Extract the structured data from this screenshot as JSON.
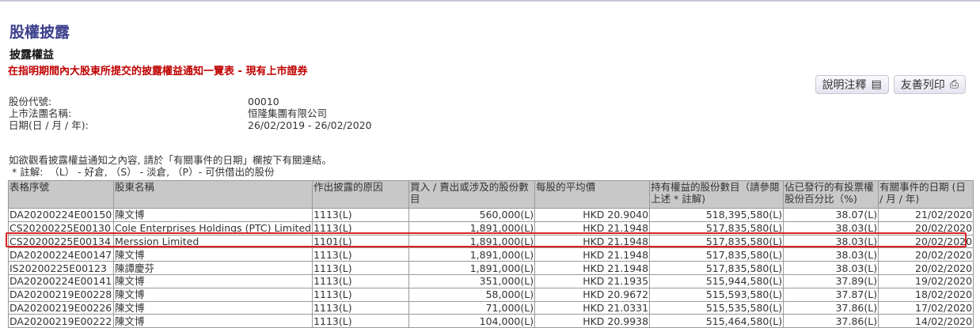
{
  "title": "股權披露",
  "subtitle": "披露權益",
  "list_title": "在指明期間內大股東所提交的披露權益通知一覽表 - 現有上市證券",
  "buttons": {
    "explain": "說明注釋",
    "print": "友善列印"
  },
  "info": [
    {
      "label": "股份代號:",
      "value": "00010"
    },
    {
      "label": "上市法團名稱:",
      "value": "恒隆集團有限公司"
    },
    {
      "label": "日期(日 / 月 / 年):",
      "value": "26/02/2019 - 26/02/2020"
    }
  ],
  "instruction": "如欲觀看披露權益通知之內容, 請於「有關事件的日期」欄按下有關連結。",
  "legend": " * 註解:  （L） - 好倉, （S） - 淡倉, （P）- 可供借出的股份",
  "columns": [
    "表格序號",
    "股東名稱",
    "作出披露的原因",
    "買入 / 賣出或涉及的股份數目",
    "每股的平均價",
    "持有權益的股份數目（請參閱上述 * 註解)",
    "佔已發行的有投票權股份百分比（%)",
    "有關事件的日期 (日 / 月 / 年)"
  ],
  "rows": [
    [
      "DA20200224E00150",
      "陳文博",
      "1113(L)",
      "560,000(L)",
      "HKD 20.9040",
      "518,395,580(L)",
      "38.07(L)",
      "21/02/2020"
    ],
    [
      "CS20200225E00130",
      "Cole Enterprises Holdings (PTC) Limited",
      "1113(L)",
      "1,891,000(L)",
      "HKD 21.1948",
      "517,835,580(L)",
      "38.03(L)",
      "20/02/2020"
    ],
    [
      "CS20200225E00134",
      "Merssion Limited",
      "1101(L)",
      "1,891,000(L)",
      "HKD 21.1948",
      "517,835,580(L)",
      "38.03(L)",
      "20/02/2020"
    ],
    [
      "DA20200224E00147",
      "陳文博",
      "1113(L)",
      "1,891,000(L)",
      "HKD 21.1948",
      "517,835,580(L)",
      "38.03(L)",
      "20/02/2020"
    ],
    [
      "IS20200225E00123",
      "陳譚慶芬",
      "1113(L)",
      "1,891,000(L)",
      "HKD 21.1948",
      "517,835,580(L)",
      "38.03(L)",
      "20/02/2020"
    ],
    [
      "DA20200224E00141",
      "陳文博",
      "1113(L)",
      "351,000(L)",
      "HKD 21.1935",
      "515,944,580(L)",
      "37.89(L)",
      "19/02/2020"
    ],
    [
      "DA20200219E00228",
      "陳文博",
      "1113(L)",
      "58,000(L)",
      "HKD 20.9672",
      "515,593,580(L)",
      "37.87(L)",
      "18/02/2020"
    ],
    [
      "DA20200219E00226",
      "陳文博",
      "1113(L)",
      "71,000(L)",
      "HKD 21.0331",
      "515,535,580(L)",
      "37.86(L)",
      "17/02/2020"
    ],
    [
      "DA20200219E00222",
      "陳文博",
      "1113(L)",
      "104,000(L)",
      "HKD 20.9938",
      "515,464,580(L)",
      "37.86(L)",
      "14/02/2020"
    ]
  ]
}
